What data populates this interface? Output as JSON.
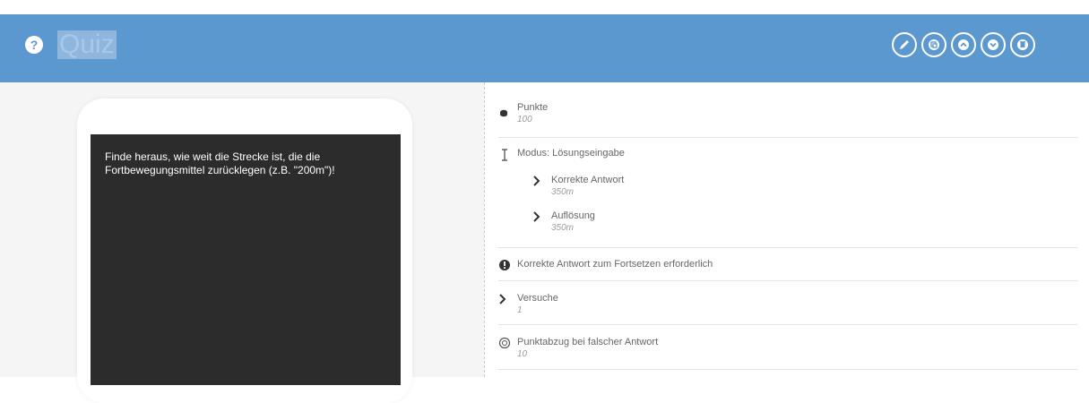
{
  "header": {
    "help_icon": "question-circle-icon",
    "title": "Quiz",
    "actions": [
      {
        "name": "edit-button",
        "icon": "pencil-icon"
      },
      {
        "name": "duplicate-button",
        "icon": "copy-icon"
      },
      {
        "name": "move-up-button",
        "icon": "chevron-up-icon"
      },
      {
        "name": "move-down-button",
        "icon": "chevron-down-icon"
      },
      {
        "name": "delete-button",
        "icon": "trash-icon"
      }
    ],
    "color": "#5c98d0"
  },
  "preview": {
    "text": "Finde heraus, wie weit die Strecke ist, die die Fortbewegungsmittel zurücklegen (z.B. \"200m\")!"
  },
  "properties": {
    "points": {
      "label": "Punkte",
      "value": "100"
    },
    "mode": {
      "label": "Modus: Lösungseingabe",
      "correct_answer": {
        "label": "Korrekte Antwort",
        "value": "350m"
      },
      "solution": {
        "label": "Auflösung",
        "value": "350m"
      }
    },
    "required": {
      "label": "Korrekte Antwort zum Fortsetzen erforderlich"
    },
    "attempts": {
      "label": "Versuche",
      "value": "1"
    },
    "penalty": {
      "label": "Punktabzug bei falscher Antwort",
      "value": "10"
    }
  }
}
